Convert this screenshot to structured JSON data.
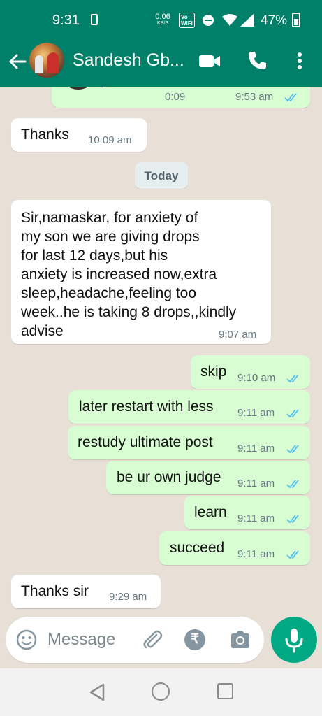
{
  "status_bar": {
    "time": "9:31",
    "net_speed_value": "0.06",
    "net_speed_unit": "KB/S",
    "volte_line1": "Vo",
    "volte_line2": "WiFi",
    "battery_percent": "47%"
  },
  "header": {
    "contact_name": "Sandesh Gb...",
    "accent_color": "#008069"
  },
  "chat": {
    "voice_message": {
      "duration": "0:09",
      "time": "9:53 am",
      "read": true
    },
    "date_separator": "Today",
    "messages": [
      {
        "dir": "in",
        "text": "Thanks",
        "time": "10:09 am"
      },
      {
        "dir": "in",
        "lines": [
          "Sir,namaskar, for anxiety of",
          "my son we are giving drops",
          "for last 12 days,but his",
          "anxiety is increased now,extra",
          "sleep,headache,feeling too",
          "week..he is taking 8 drops,,kindly",
          "advise"
        ],
        "time": "9:07 am"
      },
      {
        "dir": "out",
        "text": "skip",
        "time": "9:10 am",
        "read": true
      },
      {
        "dir": "out",
        "text": "later restart with less",
        "time": "9:11 am",
        "read": true
      },
      {
        "dir": "out",
        "text": "restudy ultimate post",
        "time": "9:11 am",
        "read": true
      },
      {
        "dir": "out",
        "text": "be ur own judge",
        "time": "9:11 am",
        "read": true
      },
      {
        "dir": "out",
        "text": "learn",
        "time": "9:11 am",
        "read": true
      },
      {
        "dir": "out",
        "text": "succeed",
        "time": "9:11 am",
        "read": true
      },
      {
        "dir": "in",
        "text": "Thanks sir",
        "time": "9:29 am"
      }
    ],
    "incoming_bubble_color": "#ffffff",
    "outgoing_bubble_color": "#d9fdd3",
    "read_tick_color": "#53bdeb"
  },
  "composer": {
    "placeholder": "Message",
    "rupee_symbol": "₹",
    "send_button_color": "#00a884"
  }
}
